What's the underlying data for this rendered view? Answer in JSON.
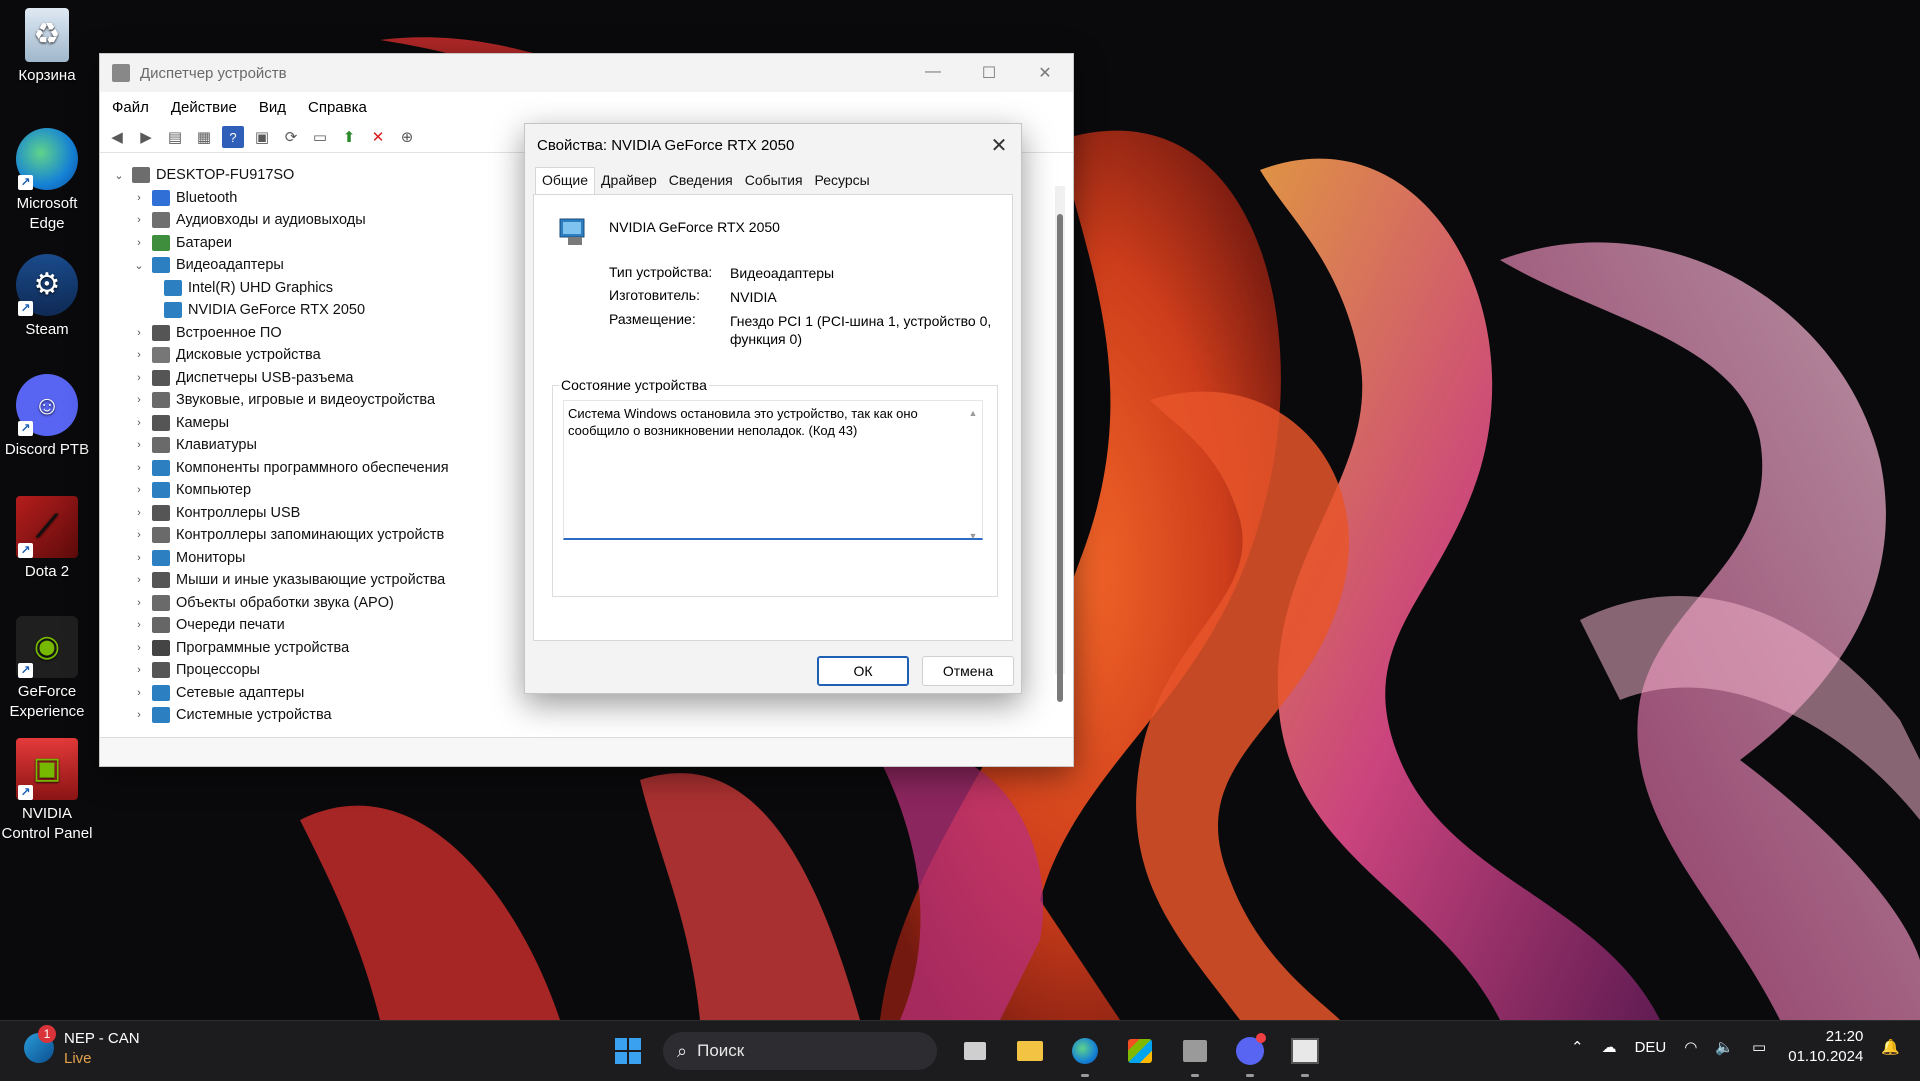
{
  "desktop": {
    "icons": [
      {
        "label": "Корзина",
        "icon": "recycle-bin-icon"
      },
      {
        "label": "Microsoft Edge",
        "icon": "edge-icon"
      },
      {
        "label": "Steam",
        "icon": "steam-icon"
      },
      {
        "label": "Discord PTB",
        "icon": "discord-icon"
      },
      {
        "label": "Dota 2",
        "icon": "dota2-icon"
      },
      {
        "label": "GeForce Experience",
        "icon": "geforce-icon"
      },
      {
        "label": "NVIDIA Control Panel",
        "icon": "nvidia-control-panel-icon"
      }
    ]
  },
  "devmgr": {
    "title": "Диспетчер устройств",
    "menu": [
      "Файл",
      "Действие",
      "Вид",
      "Справка"
    ],
    "tree": {
      "root": "DESKTOP-FU917SO",
      "items": [
        {
          "label": "Bluetooth",
          "expanded": false
        },
        {
          "label": "Аудиовходы и аудиовыходы",
          "expanded": false
        },
        {
          "label": "Батареи",
          "expanded": false
        },
        {
          "label": "Видеоадаптеры",
          "expanded": true,
          "children": [
            "Intel(R) UHD Graphics",
            "NVIDIA GeForce RTX 2050"
          ]
        },
        {
          "label": "Встроенное ПО",
          "expanded": false
        },
        {
          "label": "Дисковые устройства",
          "expanded": false
        },
        {
          "label": "Диспетчеры USB-разъема",
          "expanded": false
        },
        {
          "label": "Звуковые, игровые и видеоустройства",
          "expanded": false
        },
        {
          "label": "Камеры",
          "expanded": false
        },
        {
          "label": "Клавиатуры",
          "expanded": false
        },
        {
          "label": "Компоненты программного обеспечения",
          "expanded": false
        },
        {
          "label": "Компьютер",
          "expanded": false
        },
        {
          "label": "Контроллеры USB",
          "expanded": false
        },
        {
          "label": "Контроллеры запоминающих устройств",
          "expanded": false
        },
        {
          "label": "Мониторы",
          "expanded": false
        },
        {
          "label": "Мыши и иные указывающие устройства",
          "expanded": false
        },
        {
          "label": "Объекты обработки звука (APO)",
          "expanded": false
        },
        {
          "label": "Очереди печати",
          "expanded": false
        },
        {
          "label": "Программные устройства",
          "expanded": false
        },
        {
          "label": "Процессоры",
          "expanded": false
        },
        {
          "label": "Сетевые адаптеры",
          "expanded": false
        },
        {
          "label": "Системные устройства",
          "expanded": false
        }
      ]
    }
  },
  "props": {
    "title": "Свойства: NVIDIA GeForce RTX 2050",
    "tabs": [
      "Общие",
      "Драйвер",
      "Сведения",
      "События",
      "Ресурсы"
    ],
    "active_tab": "Общие",
    "device_name": "NVIDIA GeForce RTX 2050",
    "type_label": "Тип устройства:",
    "type_value": "Видеоадаптеры",
    "mfr_label": "Изготовитель:",
    "mfr_value": "NVIDIA",
    "loc_label": "Размещение:",
    "loc_value": "Гнездо PCI 1 (PCI-шина 1, устройство 0, функция 0)",
    "status_title": "Состояние устройства",
    "status_text": "Система Windows остановила это устройство, так как оно сообщило о возникновении неполадок. (Код 43)",
    "ok": "ОК",
    "cancel": "Отмена"
  },
  "taskbar": {
    "weather_badge": "1",
    "weather_title": "NEP - CAN",
    "weather_sub": "Live",
    "search_placeholder": "Поиск",
    "lang": "DEU",
    "time": "21:20",
    "date": "01.10.2024"
  }
}
